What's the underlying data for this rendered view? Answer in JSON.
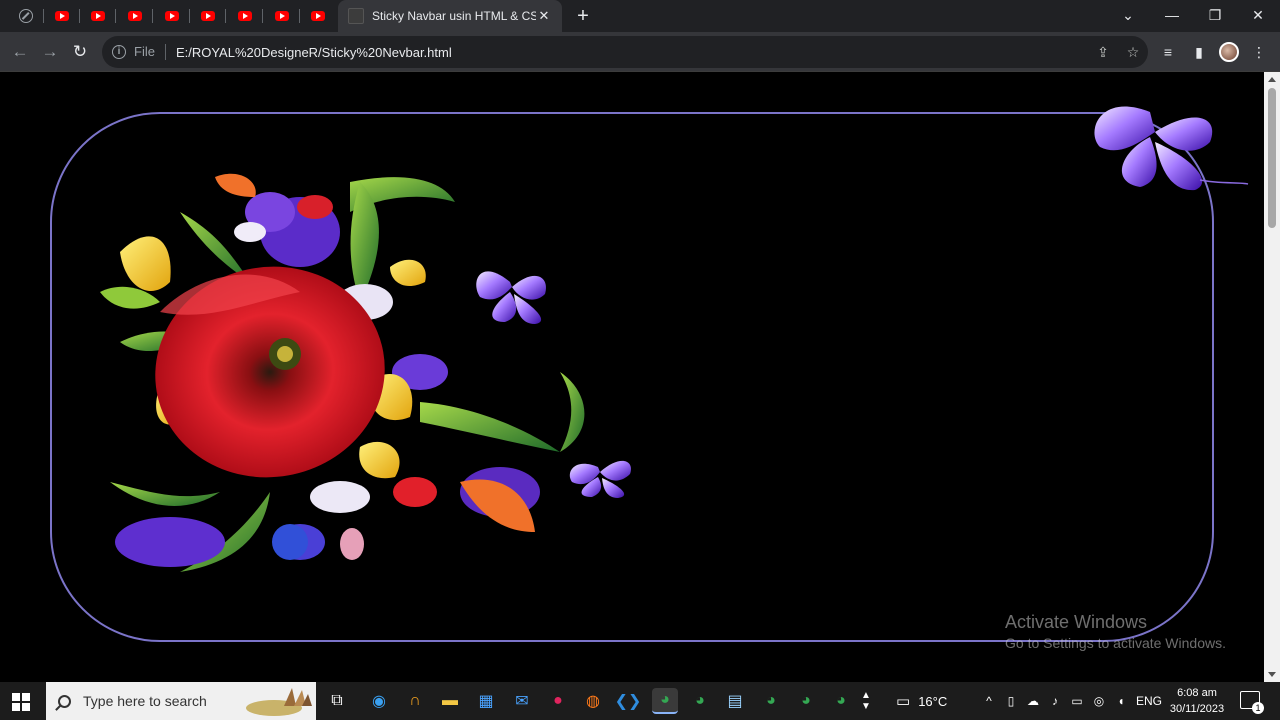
{
  "browser": {
    "pinned_tab_count": 8,
    "active_tab": {
      "title": "Sticky Navbar usin HTML & CSS",
      "close_glyph": "✕"
    },
    "new_tab_glyph": "+",
    "window_controls": {
      "tabsearch": "⌄",
      "minimize": "—",
      "restore": "❐",
      "close": "✕"
    },
    "toolbar": {
      "back": "←",
      "forward": "→",
      "reload": "↻",
      "protocol_label": "File",
      "url": "E:/ROYAL%20DesigneR/Sticky%20Nevbar.html",
      "share_glyph": "⇪",
      "bookmark_glyph": "☆",
      "reading_list_glyph": "≡",
      "sidepanel_glyph": "▮",
      "menu_glyph": "⋮"
    }
  },
  "watermark": {
    "line1": "Activate Windows",
    "line2": "Go to Settings to activate Windows."
  },
  "taskbar": {
    "search_placeholder": "Type here to search",
    "temperature": "16°C",
    "language": "ENG",
    "time": "6:08 am",
    "date": "30/11/2023",
    "notification_count": "1"
  },
  "colors": {
    "frame_border": "#7b74c9",
    "tab_bg": "#202124",
    "toolbar_bg": "#35363a",
    "youtube_red": "#ff0000"
  }
}
